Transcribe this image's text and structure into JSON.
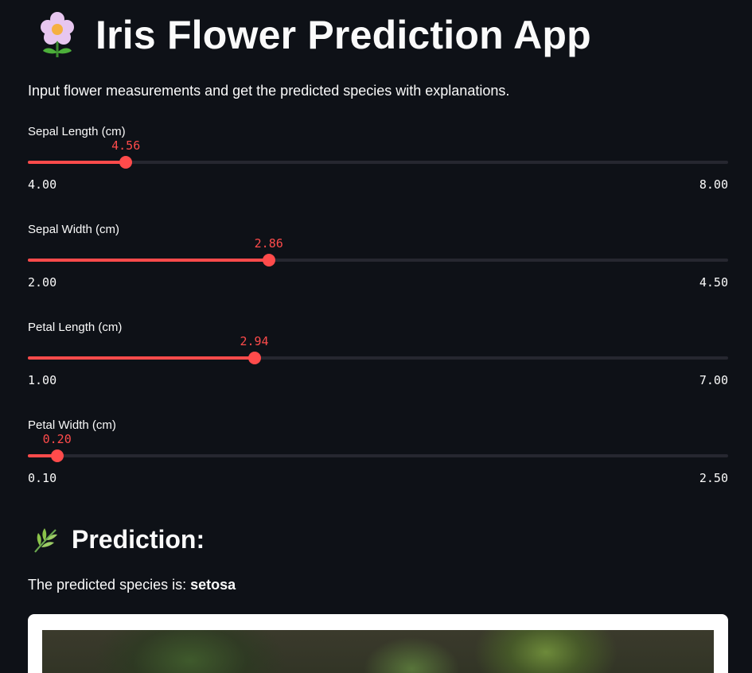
{
  "header": {
    "title": "Iris Flower Prediction App",
    "icon": "blossom-icon"
  },
  "description": "Input flower measurements and get the predicted species with explanations.",
  "sliders": [
    {
      "label": "Sepal Length (cm)",
      "value": "4.56",
      "min": "4.00",
      "max": "8.00",
      "fraction": 0.14
    },
    {
      "label": "Sepal Width (cm)",
      "value": "2.86",
      "min": "2.00",
      "max": "4.50",
      "fraction": 0.344
    },
    {
      "label": "Petal Length (cm)",
      "value": "2.94",
      "min": "1.00",
      "max": "7.00",
      "fraction": 0.3233
    },
    {
      "label": "Petal Width (cm)",
      "value": "0.20",
      "min": "0.10",
      "max": "2.50",
      "fraction": 0.0417
    }
  ],
  "prediction": {
    "heading": "Prediction:",
    "icon": "herb-icon",
    "text_prefix": "The predicted species is: ",
    "species": "setosa"
  },
  "colors": {
    "accent": "#ff4b4b",
    "background": "#0e1117",
    "track": "#262730"
  }
}
